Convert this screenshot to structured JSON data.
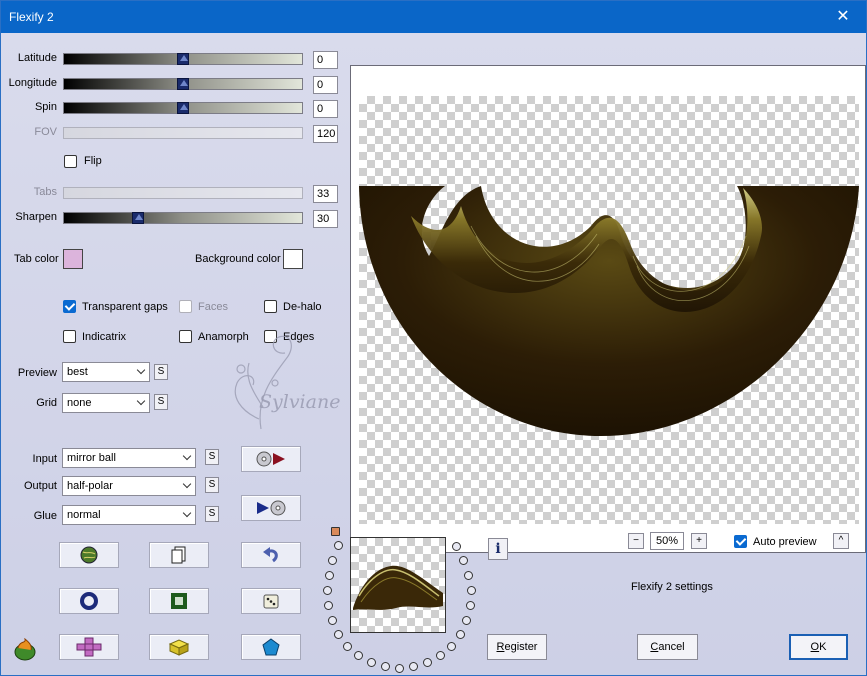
{
  "window": {
    "title": "Flexify 2",
    "close_glyph": "✕"
  },
  "sliders": {
    "latitude": {
      "label": "Latitude",
      "value": "0",
      "level": 0.5
    },
    "longitude": {
      "label": "Longitude",
      "value": "0",
      "level": 0.5
    },
    "spin": {
      "label": "Spin",
      "value": "0",
      "level": 0.5
    },
    "fov": {
      "label": "FOV",
      "value": "120"
    },
    "tabs": {
      "label": "Tabs",
      "value": "33"
    },
    "sharpen": {
      "label": "Sharpen",
      "value": "30",
      "level": 0.3
    }
  },
  "flip": {
    "label": "Flip",
    "checked": false
  },
  "colors": {
    "tab_color_label": "Tab color",
    "tab_color": "#dcb4dc",
    "bg_color_label": "Background color",
    "bg_color": "#ffffff"
  },
  "options": {
    "transparent_gaps": {
      "label": "Transparent gaps",
      "checked": true
    },
    "faces": {
      "label": "Faces",
      "checked": false
    },
    "dehalo": {
      "label": "De-halo",
      "checked": false
    },
    "indicatrix": {
      "label": "Indicatrix",
      "checked": false
    },
    "anamorph": {
      "label": "Anamorph",
      "checked": false
    },
    "edges": {
      "label": "Edges",
      "checked": false
    }
  },
  "selects": {
    "preview": {
      "label": "Preview",
      "value": "best"
    },
    "grid": {
      "label": "Grid",
      "value": "none"
    },
    "input": {
      "label": "Input",
      "value": "mirror ball"
    },
    "output": {
      "label": "Output",
      "value": "half-polar"
    },
    "glue": {
      "label": "Glue",
      "value": "normal"
    },
    "s_glyph": "S"
  },
  "watermark": "Sylviane",
  "zoom": {
    "minus": "−",
    "value": "50%",
    "plus": "+"
  },
  "auto_preview": {
    "label": "Auto preview",
    "checked": true,
    "collapse_glyph": "^"
  },
  "settings_label": "Flexify 2 settings",
  "info_glyph": "i",
  "buttons": {
    "register_u": "R",
    "register_rest": "egister",
    "cancel_u": "C",
    "cancel_rest": "ancel",
    "ok_u": "O",
    "ok_rest": "K"
  },
  "accent": "#0a66c8"
}
